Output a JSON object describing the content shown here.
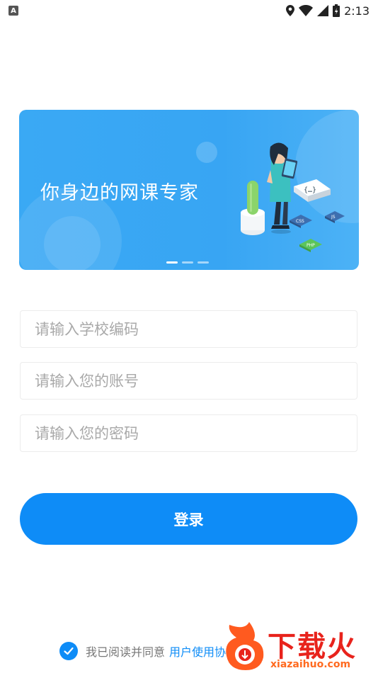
{
  "status_bar": {
    "notification_icon": "A",
    "time": "2:13"
  },
  "banner": {
    "title": "你身边的网课专家",
    "tags": [
      "CSS",
      "JS",
      "PHP"
    ],
    "pager": {
      "count": 3,
      "active_index": 0
    }
  },
  "form": {
    "school_code": {
      "placeholder": "请输入学校编码",
      "value": ""
    },
    "account": {
      "placeholder": "请输入您的账号",
      "value": ""
    },
    "password": {
      "placeholder": "请输入您的密码",
      "value": ""
    },
    "login_label": "登录"
  },
  "agreement": {
    "checked": true,
    "text": "我已阅读并同意",
    "link_text": "用户使用协议"
  },
  "watermark": {
    "name": "下载火",
    "url": "xiazaihuo.com"
  },
  "colors": {
    "accent": "#0e8cf7",
    "banner": "#38a5f3",
    "watermark": "#e8231c"
  }
}
